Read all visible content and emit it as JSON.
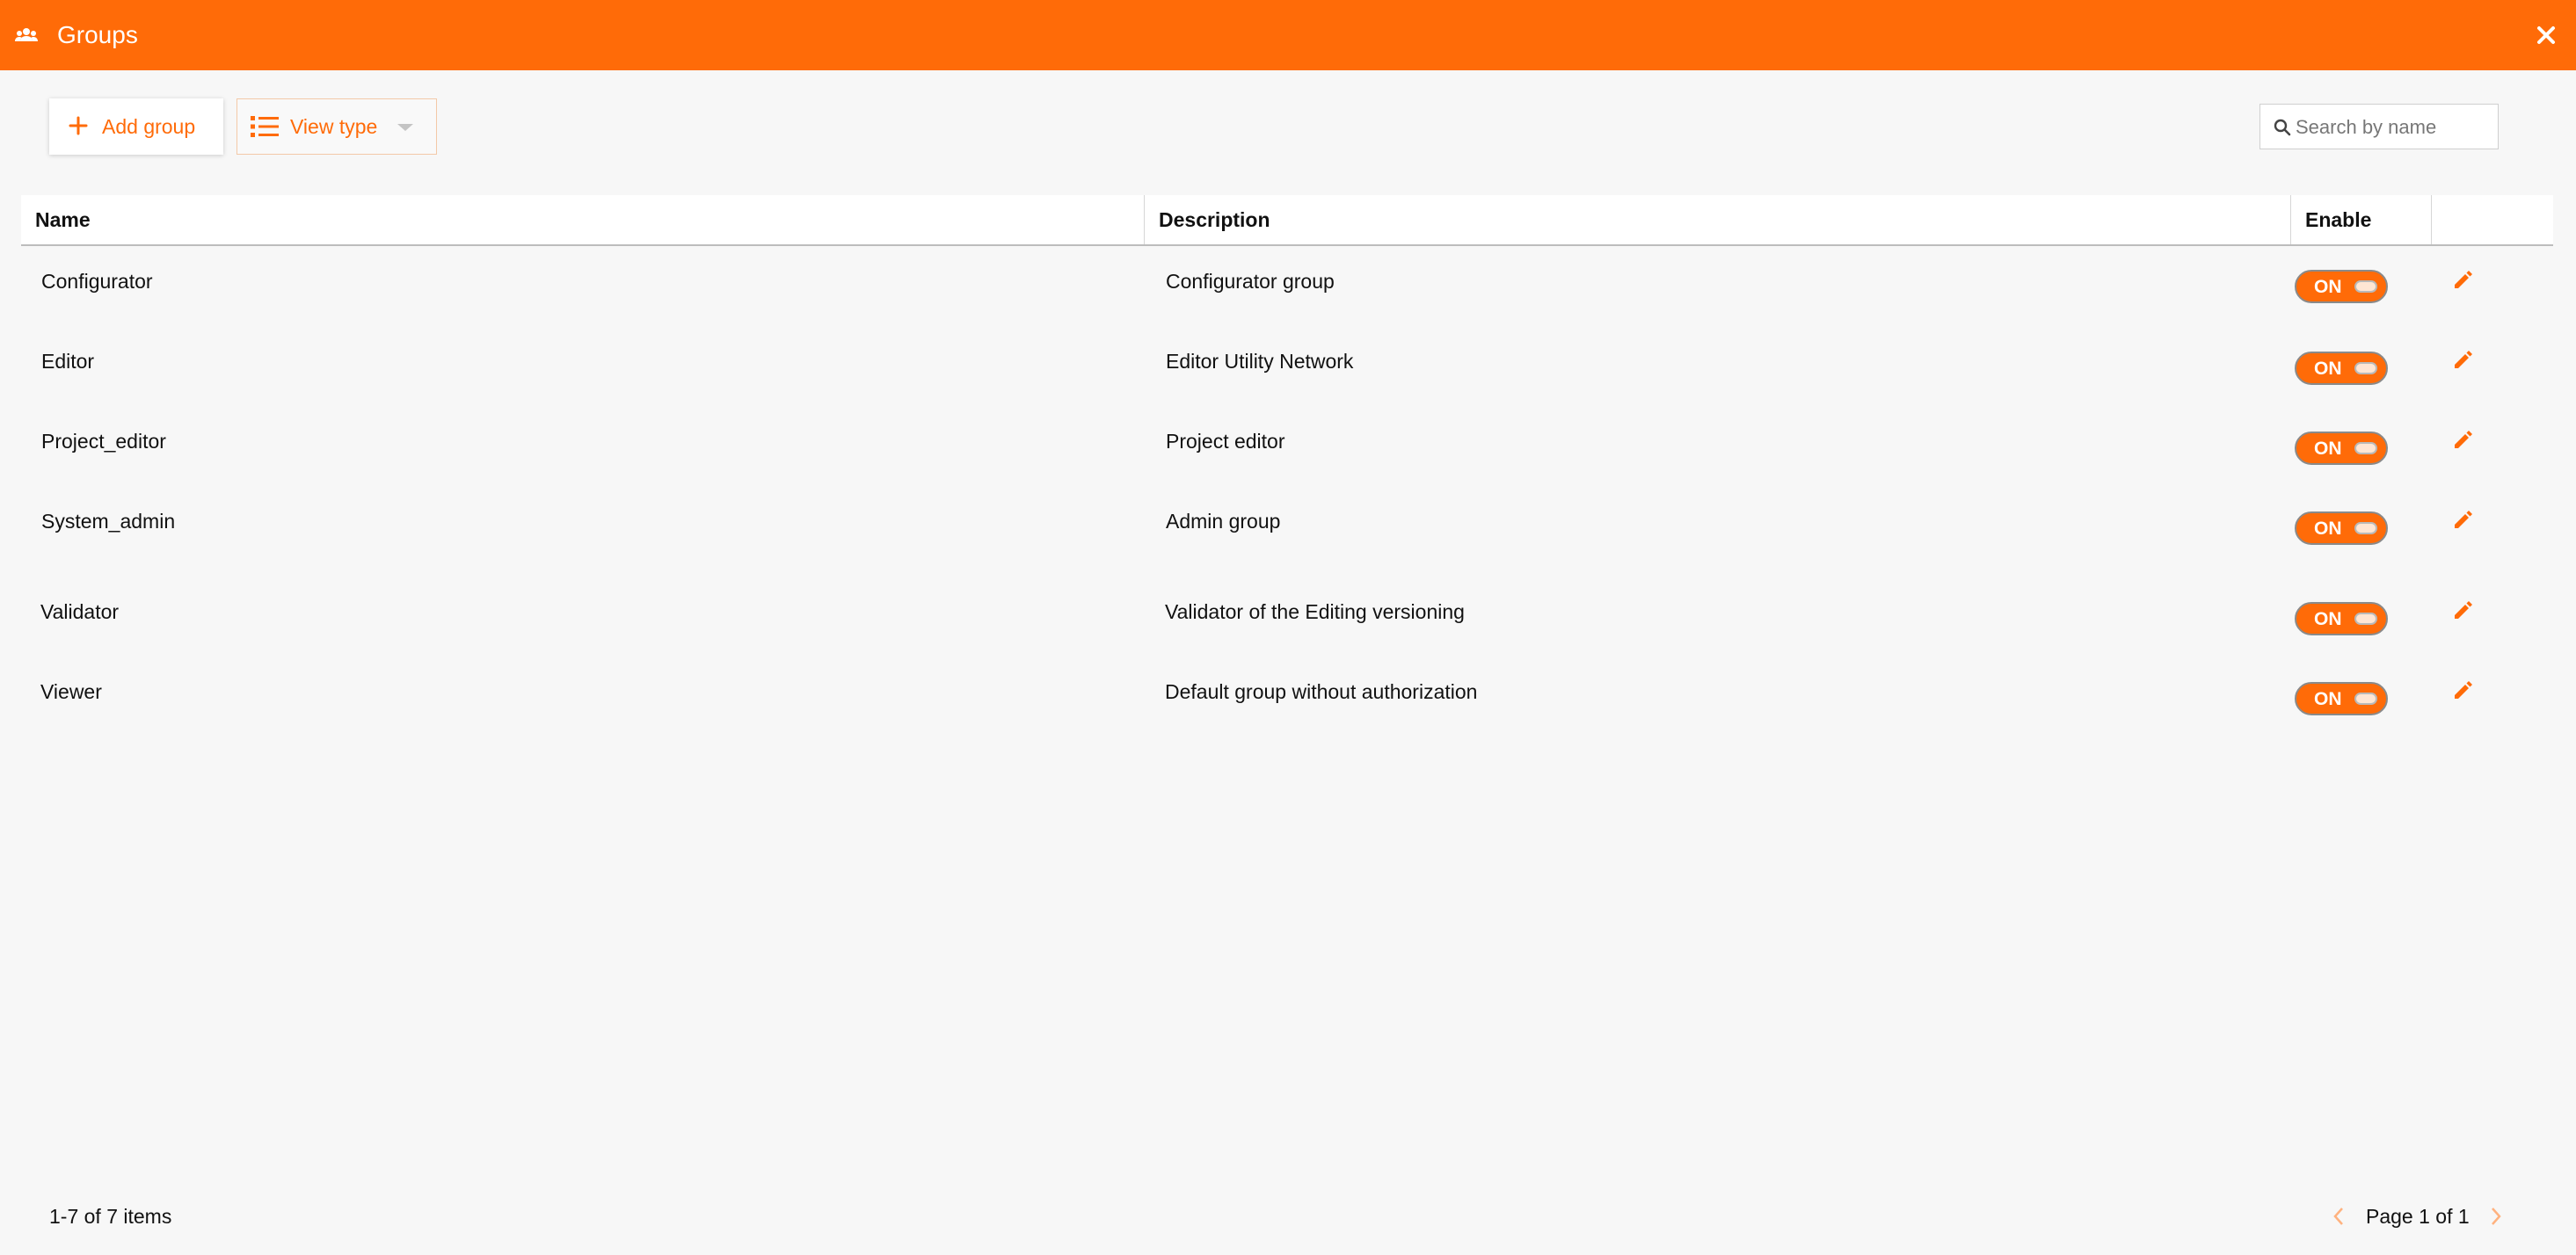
{
  "window": {
    "title": "Groups",
    "icon": "groups-icon",
    "close_icon": "close-icon"
  },
  "toolbar": {
    "add_label": "Add group",
    "view_type_label": "View type"
  },
  "search": {
    "placeholder": "Search by name",
    "value": ""
  },
  "table": {
    "headers": {
      "name": "Name",
      "description": "Description",
      "enable": "Enable"
    },
    "rows": [
      {
        "name": "Configurator",
        "description": "Configurator group",
        "enabled": "ON"
      },
      {
        "name": "Editor",
        "description": "Editor Utility Network",
        "enabled": "ON"
      },
      {
        "name": "Project_editor",
        "description": "Project editor",
        "enabled": "ON"
      },
      {
        "name": "System_admin",
        "description": "Admin group",
        "enabled": "ON"
      },
      {
        "name": "Validator",
        "description": "Validator of the Editing versioning",
        "enabled": "ON"
      },
      {
        "name": "Viewer",
        "description": "Default group without authorization",
        "enabled": "ON"
      }
    ]
  },
  "footer": {
    "items_text": "1-7 of 7 items",
    "page_text": "Page 1 of 1"
  },
  "colors": {
    "accent": "#ff6b08",
    "background": "#f7f7f7"
  }
}
